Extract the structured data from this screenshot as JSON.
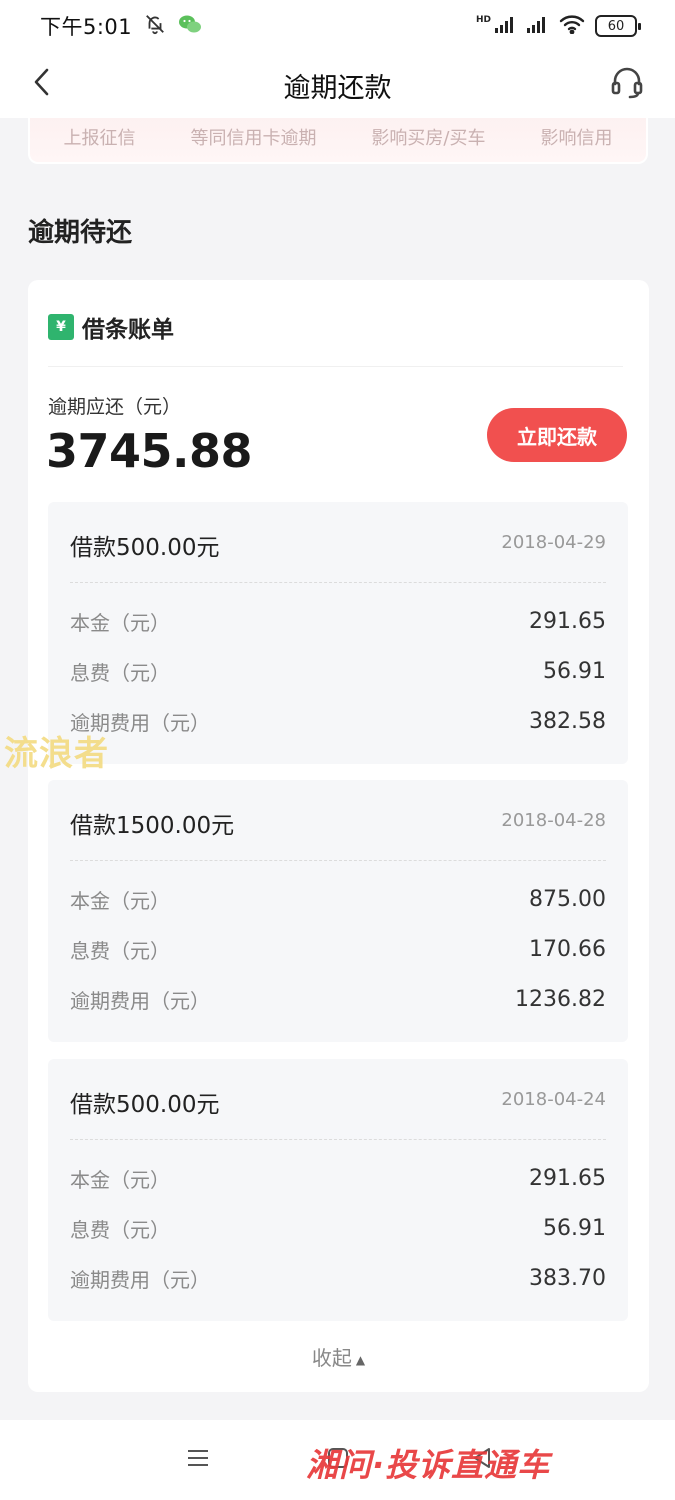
{
  "status_bar": {
    "time": "下午5:01",
    "hd": "HD",
    "battery": "60"
  },
  "nav": {
    "title": "逾期还款"
  },
  "warnings": [
    "上报征信",
    "等同信用卡逾期",
    "影响买房/买车",
    "影响信用"
  ],
  "section_title": "逾期待还",
  "bill": {
    "header_label": "借条账单",
    "badge_symbol": "¥",
    "due_label": "逾期应还（元）",
    "due_amount": "3745.88",
    "pay_button": "立即还款",
    "loans": [
      {
        "title": "借款500.00元",
        "date": "2018-04-29",
        "rows": [
          {
            "label": "本金（元）",
            "value": "291.65"
          },
          {
            "label": "息费（元）",
            "value": "56.91"
          },
          {
            "label": "逾期费用（元）",
            "value": "382.58"
          }
        ]
      },
      {
        "title": "借款1500.00元",
        "date": "2018-04-28",
        "rows": [
          {
            "label": "本金（元）",
            "value": "875.00"
          },
          {
            "label": "息费（元）",
            "value": "170.66"
          },
          {
            "label": "逾期费用（元）",
            "value": "1236.82"
          }
        ]
      },
      {
        "title": "借款500.00元",
        "date": "2018-04-24",
        "rows": [
          {
            "label": "本金（元）",
            "value": "291.65"
          },
          {
            "label": "息费（元）",
            "value": "56.91"
          },
          {
            "label": "逾期费用（元）",
            "value": "383.70"
          }
        ]
      }
    ],
    "collapse_label": "收起"
  },
  "watermarks": {
    "left": "流浪者",
    "bottom": "湘问·投诉直通车"
  },
  "colors": {
    "accent": "#f1504f",
    "badge": "#2fb46e",
    "background": "#f4f4f6"
  },
  "icons": {
    "back": "chevron-left-icon",
    "service": "headset-icon",
    "muted": "bell-off-icon",
    "wechat": "wechat-icon",
    "signal": "signal-icon",
    "wifi": "wifi-icon",
    "battery": "battery-icon",
    "menu": "menu-icon",
    "home": "home-icon",
    "nav_back": "back-triangle-icon",
    "collapse": "caret-up-icon"
  }
}
